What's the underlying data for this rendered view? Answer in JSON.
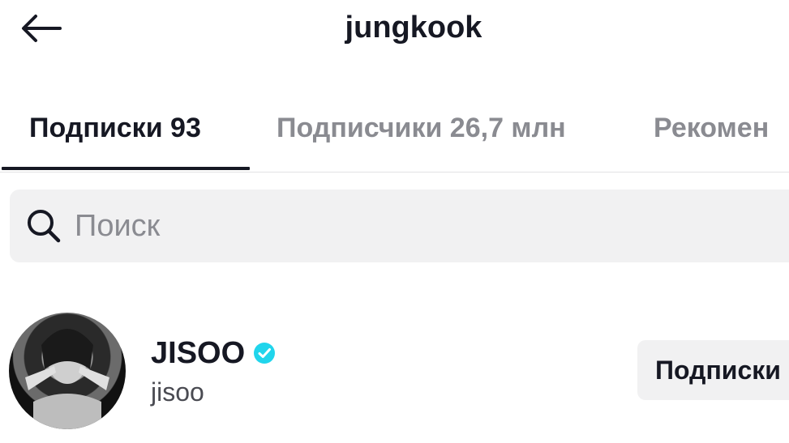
{
  "header": {
    "title": "jungkook",
    "back_icon": "arrow-left-icon"
  },
  "tabs": [
    {
      "label": "Подписки 93",
      "active": true
    },
    {
      "label": "Подписчики 26,7 млн",
      "active": false
    },
    {
      "label": "Рекомен",
      "active": false
    }
  ],
  "search": {
    "placeholder": "Поиск",
    "icon": "search-icon"
  },
  "users": [
    {
      "display_name": "JISOO",
      "username": "jisoo",
      "verified": true,
      "verified_color": "#20d5ec",
      "button_label": "Подписки"
    }
  ]
}
